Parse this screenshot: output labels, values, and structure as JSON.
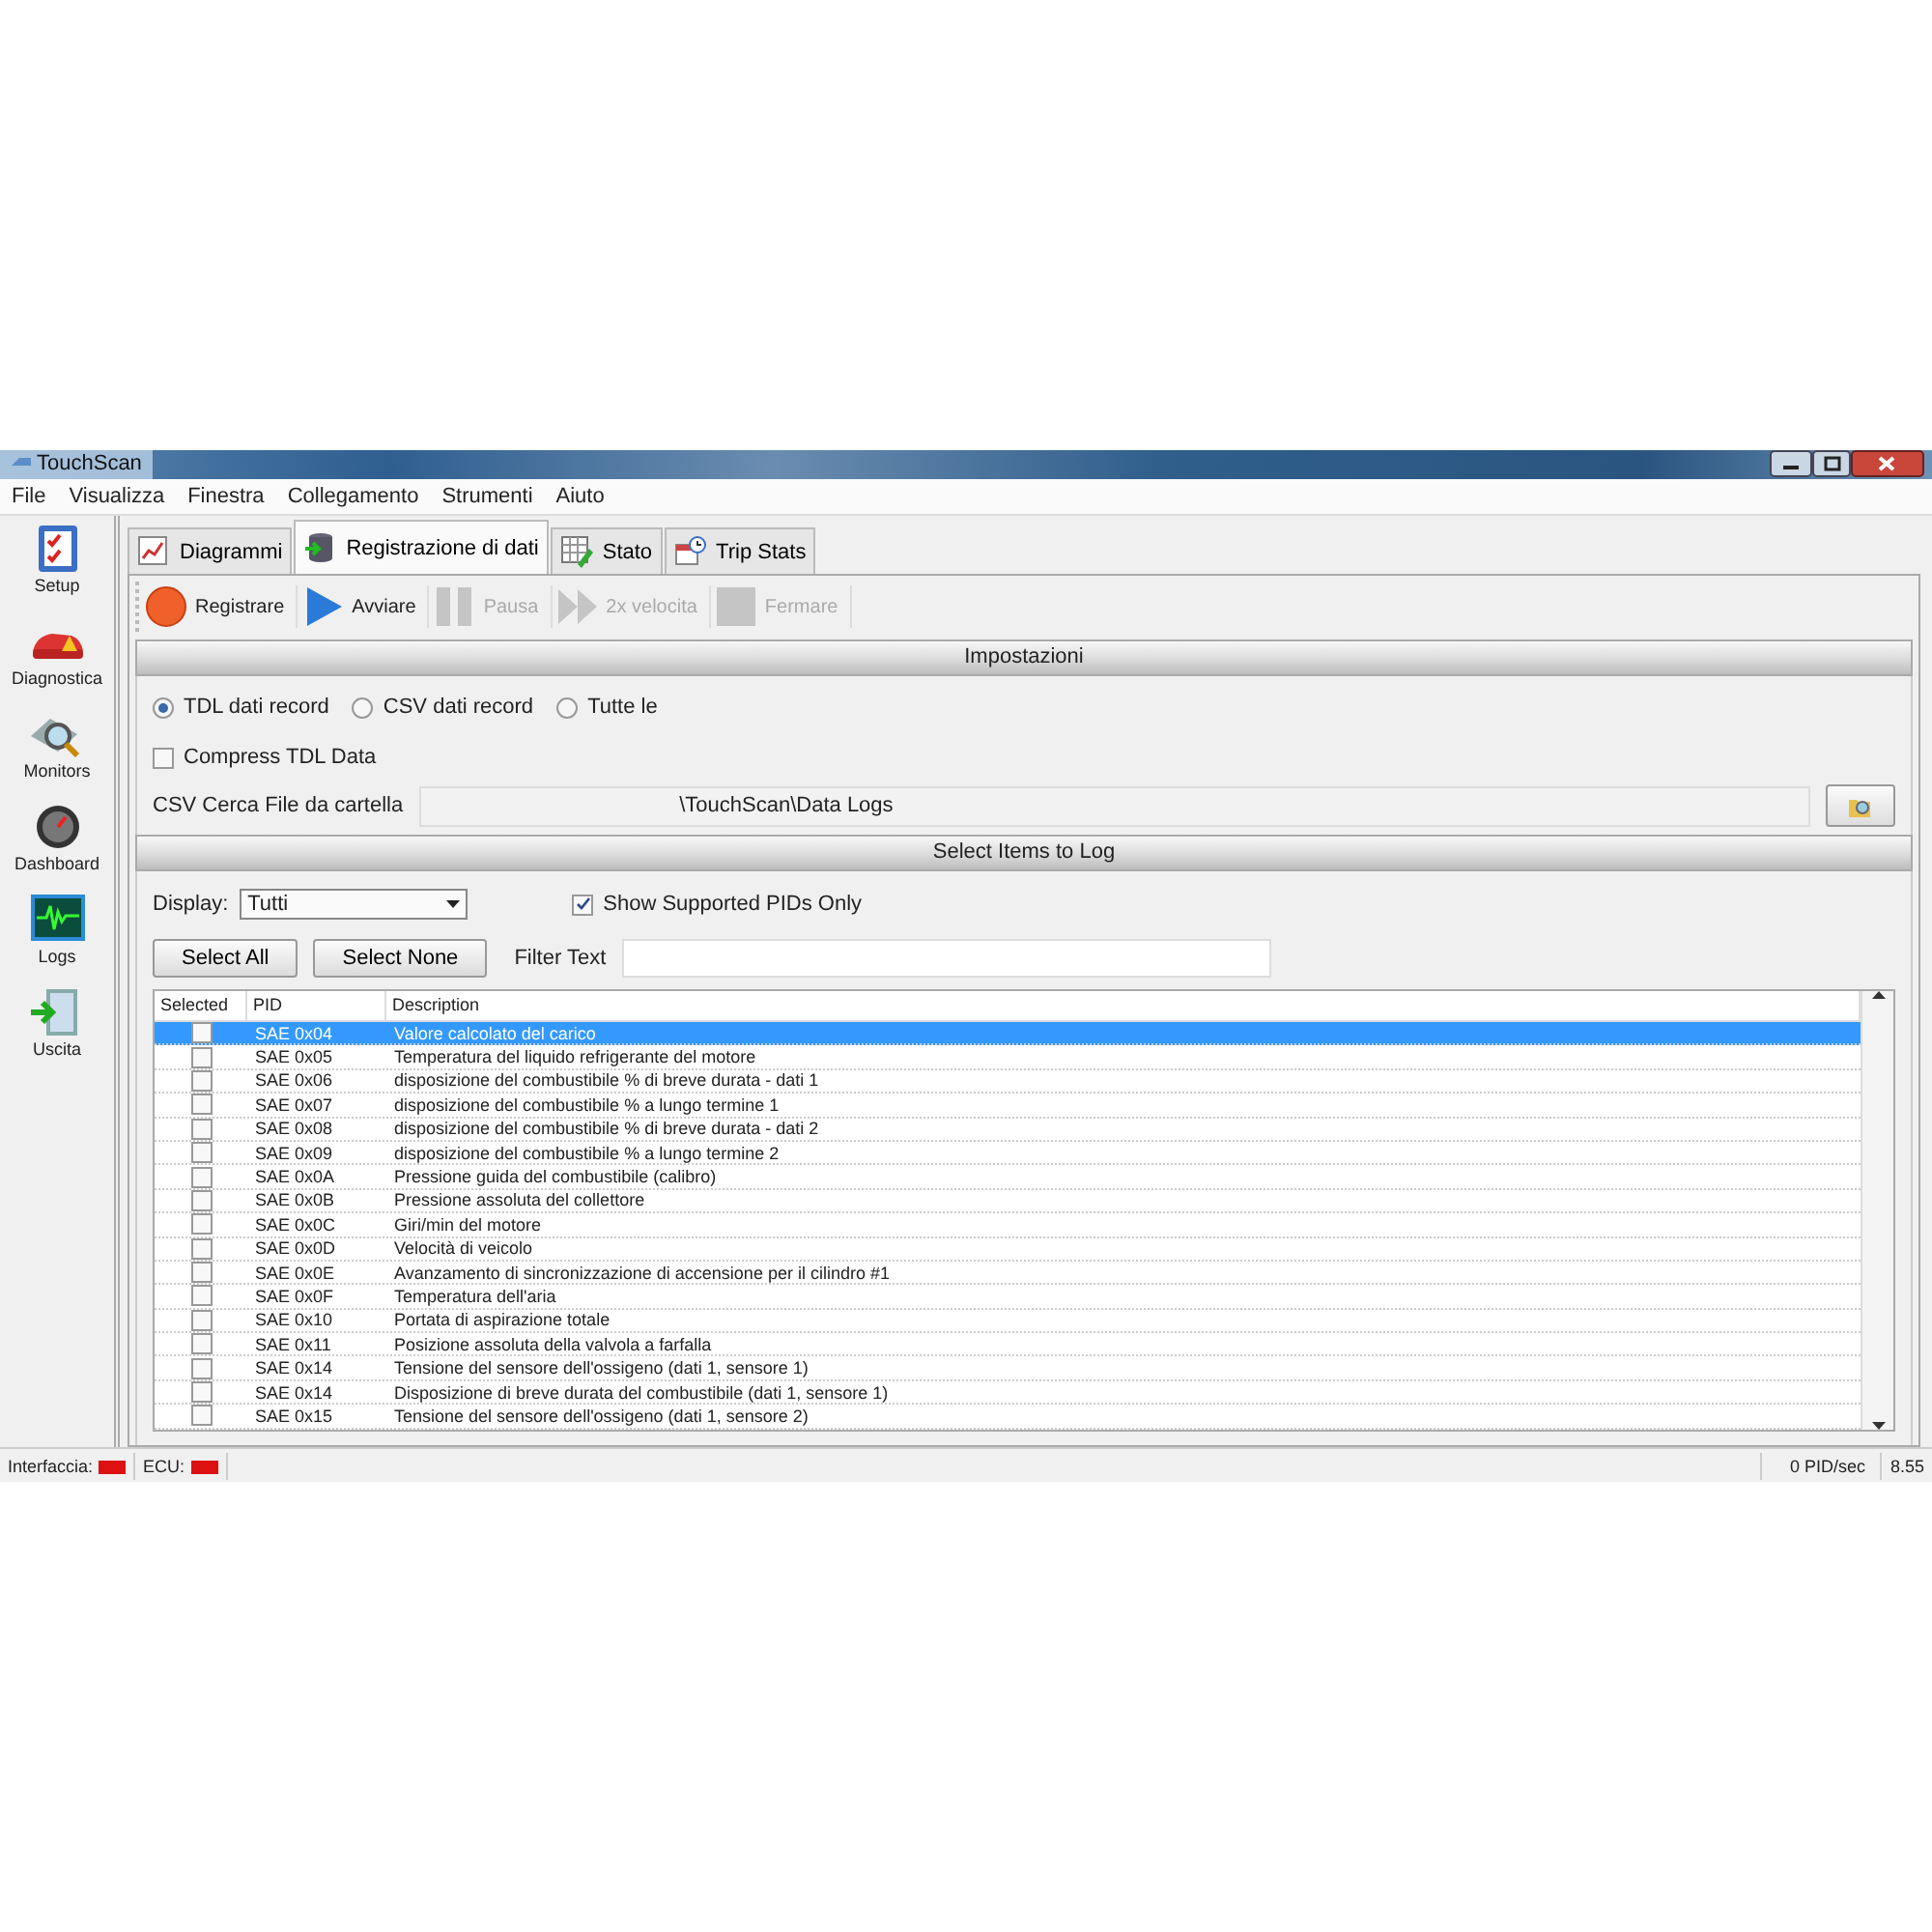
{
  "window": {
    "title": "TouchScan"
  },
  "menu": [
    "File",
    "Visualizza",
    "Finestra",
    "Collegamento",
    "Strumenti",
    "Aiuto"
  ],
  "sidebar": {
    "items": [
      {
        "label": "Setup",
        "kind": "setup"
      },
      {
        "label": "Diagnostica",
        "kind": "diagnostics"
      },
      {
        "label": "Monitors",
        "kind": "monitors"
      },
      {
        "label": "Dashboard",
        "kind": "dashboard"
      },
      {
        "label": "Logs",
        "kind": "logs"
      },
      {
        "label": "Uscita",
        "kind": "exit"
      }
    ]
  },
  "tabs": [
    {
      "label": "Diagrammi",
      "kind": "chart",
      "selected": false
    },
    {
      "label": "Registrazione di dati",
      "kind": "database",
      "selected": true
    },
    {
      "label": "Stato",
      "kind": "grid",
      "selected": false
    },
    {
      "label": "Trip Stats",
      "kind": "calendar",
      "selected": false
    }
  ],
  "toolbar": [
    {
      "label": "Registrare",
      "kind": "record",
      "disabled": false
    },
    {
      "label": "Avviare",
      "kind": "play",
      "disabled": false
    },
    {
      "label": "Pausa",
      "kind": "pause",
      "disabled": true
    },
    {
      "label": "2x velocita",
      "kind": "fast",
      "disabled": true
    },
    {
      "label": "Fermare",
      "kind": "stop",
      "disabled": true
    }
  ],
  "settings": {
    "title": "Impostazioni",
    "formats": [
      {
        "label": "TDL dati record",
        "selected": true
      },
      {
        "label": "CSV dati record",
        "selected": false
      },
      {
        "label": "Tutte le",
        "selected": false
      }
    ],
    "compress": {
      "label": "Compress TDL Data",
      "checked": false
    },
    "folder": {
      "label": "CSV Cerca File da cartella",
      "value": "\\TouchScan\\Data Logs"
    }
  },
  "select_items": {
    "title": "Select Items to Log",
    "display": {
      "label": "Display:",
      "value": "Tutti"
    },
    "supported_only": {
      "label": "Show Supported PIDs Only",
      "checked": true
    },
    "buttons": [
      "Select All",
      "Select None"
    ],
    "filter": {
      "label": "Filter Text"
    }
  },
  "table": {
    "columns": [
      "Selected",
      "PID",
      "Description"
    ],
    "rows": [
      {
        "pid": "SAE 0x04",
        "description": "Valore calcolato del carico",
        "checked": false,
        "selected": true
      },
      {
        "pid": "SAE 0x05",
        "description": "Temperatura del liquido refrigerante del motore",
        "checked": false,
        "selected": false
      },
      {
        "pid": "SAE 0x06",
        "description": "disposizione del combustibile % di breve durata - dati 1",
        "checked": false,
        "selected": false
      },
      {
        "pid": "SAE 0x07",
        "description": "disposizione del combustibile % a lungo termine 1",
        "checked": false,
        "selected": false
      },
      {
        "pid": "SAE 0x08",
        "description": "disposizione del combustibile % di breve durata - dati 2",
        "checked": false,
        "selected": false
      },
      {
        "pid": "SAE 0x09",
        "description": "disposizione del combustibile % a lungo termine 2",
        "checked": false,
        "selected": false
      },
      {
        "pid": "SAE 0x0A",
        "description": "Pressione  guida del combustibile (calibro)",
        "checked": false,
        "selected": false
      },
      {
        "pid": "SAE 0x0B",
        "description": "Pressione assoluta del collettore",
        "checked": false,
        "selected": false
      },
      {
        "pid": "SAE 0x0C",
        "description": "Giri/min del motore",
        "checked": false,
        "selected": false
      },
      {
        "pid": "SAE 0x0D",
        "description": "Velocità di veicolo",
        "checked": false,
        "selected": false
      },
      {
        "pid": "SAE 0x0E",
        "description": "Avanzamento di sincronizzazione di accensione per il cilindro #1",
        "checked": false,
        "selected": false
      },
      {
        "pid": "SAE 0x0F",
        "description": "Temperatura dell'aria",
        "checked": false,
        "selected": false
      },
      {
        "pid": "SAE 0x10",
        "description": "Portata di aspirazione totale",
        "checked": false,
        "selected": false
      },
      {
        "pid": "SAE 0x11",
        "description": "Posizione assoluta della valvola a farfalla",
        "checked": false,
        "selected": false
      },
      {
        "pid": "SAE 0x14",
        "description": "Tensione del sensore dell'ossigeno (dati 1, sensore 1)",
        "checked": false,
        "selected": false
      },
      {
        "pid": "SAE 0x14",
        "description": "Disposizione di breve durata del combustibile (dati 1, sensore 1)",
        "checked": false,
        "selected": false
      },
      {
        "pid": "SAE 0x15",
        "description": "Tensione del sensore dell'ossigeno (dati 1, sensore 2)",
        "checked": false,
        "selected": false
      }
    ]
  },
  "status_bar": {
    "indicators": [
      {
        "label": "Interfaccia:",
        "color": "#dd1111"
      },
      {
        "label": "ECU:",
        "color": "#dd1111"
      }
    ],
    "rate": "0 PID/sec",
    "version": "8.55"
  }
}
